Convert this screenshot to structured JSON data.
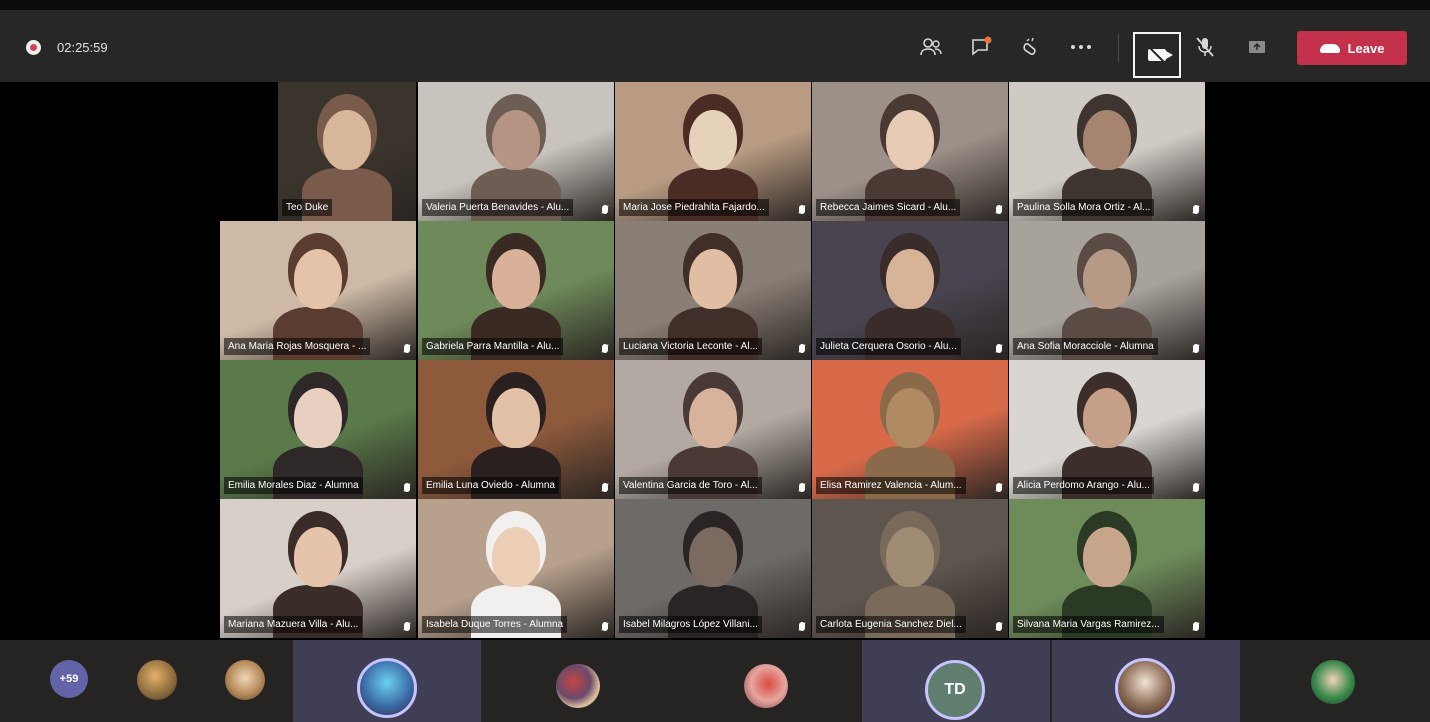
{
  "meeting": {
    "timer": "02:25:59",
    "leave_label": "Leave",
    "recording_color": "#d94052",
    "leave_color": "#c4314b"
  },
  "toolbar_icons": [
    "participants-icon",
    "chat-icon",
    "reactions-icon",
    "more-options-icon",
    "camera-off-icon",
    "mic-off-icon",
    "share-screen-icon"
  ],
  "participants": [
    {
      "name": "Teo Duke",
      "row": 0,
      "col": 0
    },
    {
      "name": "Valeria Puerta Benavides - Alu...",
      "row": 0,
      "col": 1
    },
    {
      "name": "Maria Jose Piedrahita Fajardo...",
      "row": 0,
      "col": 2
    },
    {
      "name": "Rebecca Jaimes Sicard - Alu...",
      "row": 0,
      "col": 3
    },
    {
      "name": "Paulina Solla Mora Ortiz - Al...",
      "row": 0,
      "col": 4
    },
    {
      "name": "Ana Maria Rojas Mosquera - ...",
      "row": 1,
      "col": 0
    },
    {
      "name": "Gabriela Parra Mantilla - Alu...",
      "row": 1,
      "col": 1
    },
    {
      "name": "Luciana Victoria Leconte - Al...",
      "row": 1,
      "col": 2
    },
    {
      "name": "Julieta Cerquera Osorio - Alu...",
      "row": 1,
      "col": 3
    },
    {
      "name": "Ana Sofia Moracciole - Alumna",
      "row": 1,
      "col": 4
    },
    {
      "name": "Emilia Morales Diaz - Alumna",
      "row": 2,
      "col": 0
    },
    {
      "name": "Emilia Luna Oviedo - Alumna",
      "row": 2,
      "col": 1
    },
    {
      "name": "Valentina Garcia de Toro - Al...",
      "row": 2,
      "col": 2
    },
    {
      "name": "Elisa Ramirez Valencia - Alum...",
      "row": 2,
      "col": 3
    },
    {
      "name": "Alicia Perdomo Arango - Alu...",
      "row": 2,
      "col": 4
    },
    {
      "name": "Mariana Mazuera Villa - Alu...",
      "row": 3,
      "col": 0
    },
    {
      "name": "Isabela Duque Torres - Alumna",
      "row": 3,
      "col": 1
    },
    {
      "name": "Isabel Milagros López Villani...",
      "row": 3,
      "col": 2
    },
    {
      "name": "Carlota Eugenia Sanchez Diel...",
      "row": 3,
      "col": 3
    },
    {
      "name": "Silvana Maria Vargas Ramirez...",
      "row": 3,
      "col": 4
    }
  ],
  "roster": {
    "overflow_count": "+59",
    "initials": "TD"
  }
}
